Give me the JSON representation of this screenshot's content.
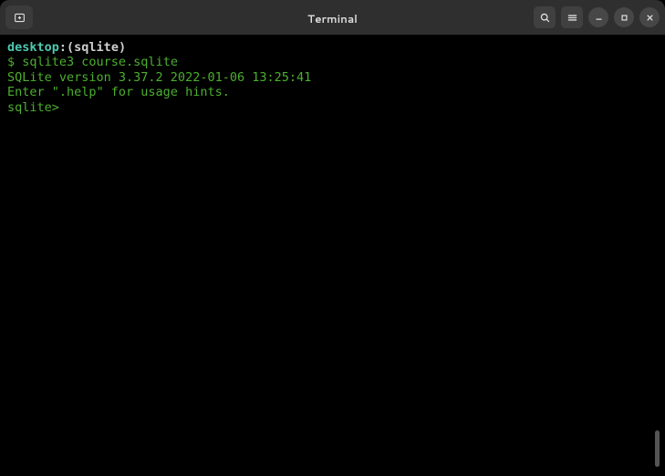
{
  "window": {
    "title": "Terminal"
  },
  "titlebar": {
    "newtab_icon": "new-tab-icon",
    "search_icon": "search-icon",
    "menu_icon": "menu-icon",
    "minimize_icon": "minimize-icon",
    "maximize_icon": "maximize-icon",
    "close_icon": "close-icon"
  },
  "terminal": {
    "prompt_location": "desktop",
    "prompt_path_sep": ":",
    "prompt_path": "(sqlite)",
    "shell_symbol": "$ ",
    "command": "sqlite3 course.sqlite",
    "version_line": "SQLite version 3.37.2 2022-01-06 13:25:41",
    "help_line": "Enter \".help\" for usage hints.",
    "sqlite_prompt": "sqlite> "
  }
}
